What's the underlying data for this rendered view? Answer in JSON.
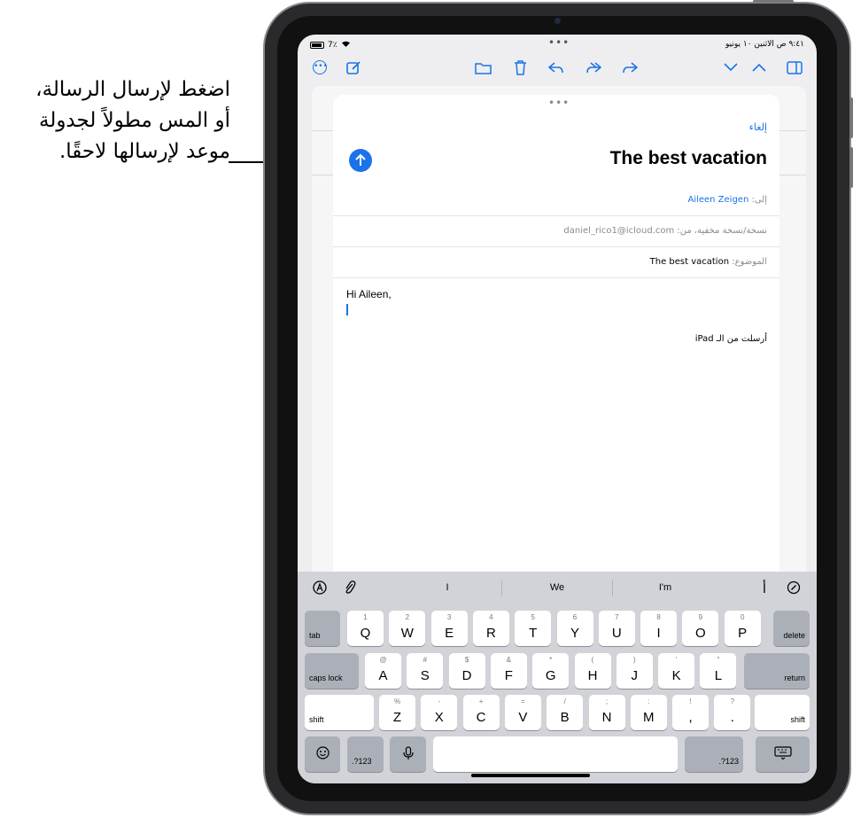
{
  "callout": {
    "line1": "اضغط لإرسال الرسالة،",
    "line2": "أو المس مطولاً لجدولة",
    "line3": "موعد لإرسالها لاحقًا."
  },
  "status_bar": {
    "left": "‎7٪‎",
    "center": "•••",
    "right": "٩:٤١ ص  الاثنين ١٠ يونيو"
  },
  "toolbar": {
    "more_icon": "ellipsis-circle-icon",
    "compose_icon": "compose-icon",
    "folder_icon": "folder-icon",
    "trash_icon": "trash-icon",
    "reply_icon": "reply-icon",
    "reply_all_icon": "reply-all-icon",
    "forward_icon": "forward-icon",
    "down_icon": "chevron-down-icon",
    "up_icon": "chevron-up-icon",
    "sidebar_icon": "sidebar-icon"
  },
  "compose": {
    "grabber": "•••",
    "cancel": "إلغاء",
    "title": "The best vacation",
    "send_icon": "arrow-up-icon",
    "to_label": "إلى:",
    "to_value": "Aileen Zeigen",
    "cc_label": "نسخة/نسخة مخفية، من:",
    "cc_value": "daniel_rico1@icloud.com",
    "subject_label": "الموضوع:",
    "subject_value": "The best vacation",
    "body": "Hi Aileen,",
    "signature": "أرسلت من الـ iPad"
  },
  "keyboard": {
    "suggestions": [
      "I",
      "We",
      "I'm"
    ],
    "row1": [
      {
        "main": "Q",
        "alt": "1"
      },
      {
        "main": "W",
        "alt": "2"
      },
      {
        "main": "E",
        "alt": "3"
      },
      {
        "main": "R",
        "alt": "4"
      },
      {
        "main": "T",
        "alt": "5"
      },
      {
        "main": "Y",
        "alt": "6"
      },
      {
        "main": "U",
        "alt": "7"
      },
      {
        "main": "I",
        "alt": "8"
      },
      {
        "main": "O",
        "alt": "9"
      },
      {
        "main": "P",
        "alt": "0"
      }
    ],
    "row2": [
      {
        "main": "A",
        "alt": "@"
      },
      {
        "main": "S",
        "alt": "#"
      },
      {
        "main": "D",
        "alt": "$"
      },
      {
        "main": "F",
        "alt": "&"
      },
      {
        "main": "G",
        "alt": "*"
      },
      {
        "main": "H",
        "alt": "("
      },
      {
        "main": "J",
        "alt": ")"
      },
      {
        "main": "K",
        "alt": "'"
      },
      {
        "main": "L",
        "alt": "\""
      }
    ],
    "row3": [
      {
        "main": "Z",
        "alt": "%"
      },
      {
        "main": "X",
        "alt": "-"
      },
      {
        "main": "C",
        "alt": "+"
      },
      {
        "main": "V",
        "alt": "="
      },
      {
        "main": "B",
        "alt": "/"
      },
      {
        "main": "N",
        "alt": ";"
      },
      {
        "main": "M",
        "alt": ":"
      },
      {
        "main": ",",
        "alt": "!"
      },
      {
        "main": ".",
        "alt": "?"
      }
    ],
    "tab": "tab",
    "delete": "delete",
    "caps_lock": "caps lock",
    "return": "return",
    "shift_left": "shift",
    "shift_right": "shift",
    "numbers_left": ".?123",
    "numbers_right": ".?123",
    "emoji_icon": "emoji-icon",
    "mic_icon": "microphone-icon",
    "dismiss_icon": "keyboard-dismiss-icon",
    "format_icon": "text-format-icon",
    "attach_icon": "paperclip-icon",
    "lang_label": "أ",
    "writing_icon": "writing-tools-icon"
  }
}
